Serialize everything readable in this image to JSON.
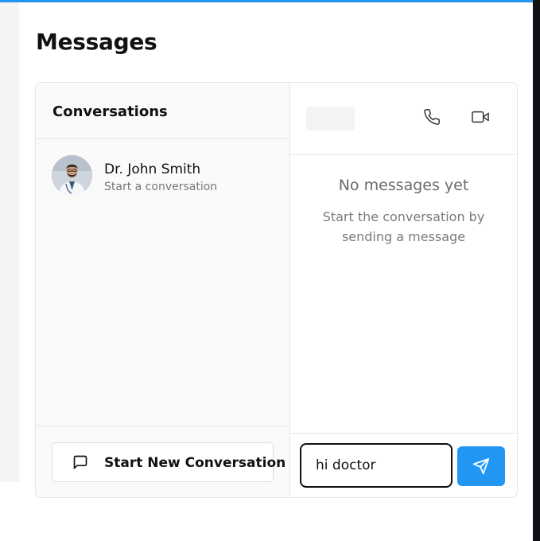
{
  "page": {
    "title": "Messages",
    "accent_color": "#2196f3"
  },
  "sidebar": {
    "title": "Conversations",
    "conversations": [
      {
        "name": "Dr. John Smith",
        "preview": "Start a conversation",
        "avatar": "doctor-avatar"
      }
    ],
    "new_conversation_label": "Start New Conversation",
    "new_conversation_icon": "message-square-icon"
  },
  "chat": {
    "header_icons": [
      "phone-icon",
      "video-icon"
    ],
    "empty_title": "No messages yet",
    "empty_subtitle": "Start the conversation by sending a message",
    "input_value": "hi doctor",
    "send_icon": "send-icon",
    "send_color": "#2196f3"
  }
}
